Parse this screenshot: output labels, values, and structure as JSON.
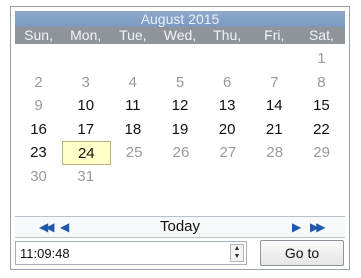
{
  "calendar": {
    "title": "August 2015",
    "days_of_week": [
      "Sun,",
      "Mon,",
      "Tue,",
      "Wed,",
      "Thu,",
      "Fri,",
      "Sat,"
    ],
    "weeks": [
      [
        {
          "d": "",
          "t": "blank"
        },
        {
          "d": "",
          "t": "blank"
        },
        {
          "d": "",
          "t": "blank"
        },
        {
          "d": "",
          "t": "blank"
        },
        {
          "d": "",
          "t": "blank"
        },
        {
          "d": "",
          "t": "blank"
        },
        {
          "d": "1",
          "t": "other"
        }
      ],
      [
        {
          "d": "2",
          "t": "other"
        },
        {
          "d": "3",
          "t": "other"
        },
        {
          "d": "4",
          "t": "other"
        },
        {
          "d": "5",
          "t": "other"
        },
        {
          "d": "6",
          "t": "other"
        },
        {
          "d": "7",
          "t": "other"
        },
        {
          "d": "8",
          "t": "other"
        }
      ],
      [
        {
          "d": "9",
          "t": "other"
        },
        {
          "d": "10",
          "t": "cur"
        },
        {
          "d": "11",
          "t": "cur"
        },
        {
          "d": "12",
          "t": "cur"
        },
        {
          "d": "13",
          "t": "cur"
        },
        {
          "d": "14",
          "t": "cur"
        },
        {
          "d": "15",
          "t": "cur"
        }
      ],
      [
        {
          "d": "16",
          "t": "cur"
        },
        {
          "d": "17",
          "t": "cur"
        },
        {
          "d": "18",
          "t": "cur"
        },
        {
          "d": "19",
          "t": "cur"
        },
        {
          "d": "20",
          "t": "cur"
        },
        {
          "d": "21",
          "t": "cur"
        },
        {
          "d": "22",
          "t": "cur"
        }
      ],
      [
        {
          "d": "23",
          "t": "cur"
        },
        {
          "d": "24",
          "t": "today"
        },
        {
          "d": "25",
          "t": "other"
        },
        {
          "d": "26",
          "t": "other"
        },
        {
          "d": "27",
          "t": "other"
        },
        {
          "d": "28",
          "t": "other"
        },
        {
          "d": "29",
          "t": "other"
        }
      ],
      [
        {
          "d": "30",
          "t": "other"
        },
        {
          "d": "31",
          "t": "other"
        },
        {
          "d": "",
          "t": "blank"
        },
        {
          "d": "",
          "t": "blank"
        },
        {
          "d": "",
          "t": "blank"
        },
        {
          "d": "",
          "t": "blank"
        },
        {
          "d": "",
          "t": "blank"
        }
      ]
    ],
    "selected_day": "24"
  },
  "nav": {
    "prev_year_icon": "double-left-arrow",
    "prev_month_icon": "left-arrow",
    "today_label": "Today",
    "next_month_icon": "right-arrow",
    "next_year_icon": "double-right-arrow",
    "arrow_color": "#1e5aa8"
  },
  "time": {
    "value": "11:09:48"
  },
  "go_button": {
    "label": "Go to"
  },
  "colors": {
    "title_bg": "#8ea9cb",
    "dow_bg": "#8e9499",
    "today_bg": "#ffffc8",
    "other_day_text": "#9a9a9a"
  }
}
